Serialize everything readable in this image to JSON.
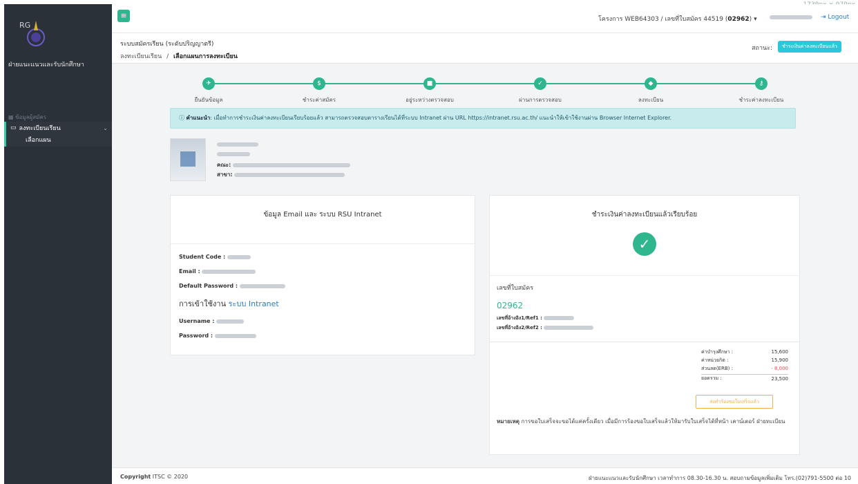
{
  "window": {
    "size_label": "1739px × 979px"
  },
  "sidebar": {
    "brand_mark": "RG",
    "brand_title": "ฝ่ายแนะแนวและรับนักศึกษา",
    "section": "ข้อมูลผู้สมัคร",
    "menu_label": "ลงทะเบียนเรียน",
    "submenu_label": "เลือกแผน"
  },
  "topbar": {
    "project": "โครงการ WEB64303 / เลขที่ใบสมัคร 44519 (",
    "project_code": "02962",
    "project_end": ")",
    "logout": "Logout"
  },
  "header": {
    "title": "ระบบสมัครเรียน (ระดับปริญญาตรี)",
    "crumb_1": "ลงทะเบียนเรียน",
    "crumb_sep": "/",
    "crumb_2": "เลือกแผนการลงทะเบียน",
    "status_label": "สถานะ:",
    "status_badge": "ชำระเงินค่าลงทะเบียนแล้ว"
  },
  "steps": [
    {
      "label": "ยืนยันข้อมูล",
      "icon": "paper-plane-icon"
    },
    {
      "label": "ชำระค่าสมัคร",
      "icon": "money-icon"
    },
    {
      "label": "อยู่ระหว่างตรวจสอบ",
      "icon": "briefcase-icon"
    },
    {
      "label": "ผ่านการตรวจสอบ",
      "icon": "check-icon"
    },
    {
      "label": "ลงทะเบียน",
      "icon": "tag-icon"
    },
    {
      "label": "ชำระค่าลงทะเบียน",
      "icon": "key-icon"
    }
  ],
  "alert": {
    "prefix": "คำแนะนำ",
    "text": ": เมื่อทำการชำระเงินค่าลงทะเบียนเรียบร้อยแล้ว สามารถตรวจสอบตารางเรียนได้ที่ระบบ Intranet ผ่าน URL https://intranet.rsu.ac.th/ แนะนำให้เข้าใช้งานผ่าน Browser Internet Explorer."
  },
  "profile": {
    "faculty_label": "คณะ",
    "major_label": "สาขา"
  },
  "email_card": {
    "title": "ข้อมูล Email และ ระบบ RSU Intranet",
    "student_code_label": "Student Code :",
    "email_label": "Email :",
    "default_password_label": "Default Password :",
    "intranet_title": "การเข้าใช้งาน",
    "intranet_link": "ระบบ Intranet",
    "username_label": "Username :",
    "password_label": "Password :"
  },
  "pay_card": {
    "title": "ชำระเงินค่าลงทะเบียนแล้วเรียบร้อย",
    "app_no_label": "เลขที่ใบสมัคร",
    "app_no": "02962",
    "ref1_label": "เลขที่อ้างอิง1/Ref1 :",
    "ref2_label": "เลขที่อ้างอิง2/Ref2 :",
    "fees": [
      {
        "label": "ค่าบำรุงศึกษา :",
        "value": "15,600"
      },
      {
        "label": "ค่าหน่วยกิต :",
        "value": "15,900"
      },
      {
        "label": "ส่วนลด(ERB) :",
        "value": "- 8,000"
      },
      {
        "label": "ยอดรวม :",
        "value": "23,500"
      }
    ],
    "request_button": "ส่งคำร้องขอใบเสร็จแล้ว",
    "note_label": "หมายเหตุ",
    "note_text": " การขอใบเสร็จจะขอได้แค่ครั้งเดียว เมื่อมีการร้องขอใบเสร็จแล้วให้มารับใบเสร็จได้ที่หน้า เคาน์เตอร์ ฝ่ายทะเบียน"
  },
  "footer": {
    "copyright_label": "Copyright",
    "copyright_text": " ITSC © 2020",
    "right_text": "ฝ่ายแนะแนวและรับนักศึกษา เวลาทำการ 08.30-16.30 น. สอบถามข้อมูลเพิ่มเติม โทร.(02)791-5500 ต่อ 10"
  },
  "colors": {
    "accent": "#2fb68f",
    "sidebar": "#2b3138",
    "info": "#2cc7d8",
    "link": "#2b7cc4",
    "warning": "#f0b14a",
    "danger": "#e05050"
  }
}
